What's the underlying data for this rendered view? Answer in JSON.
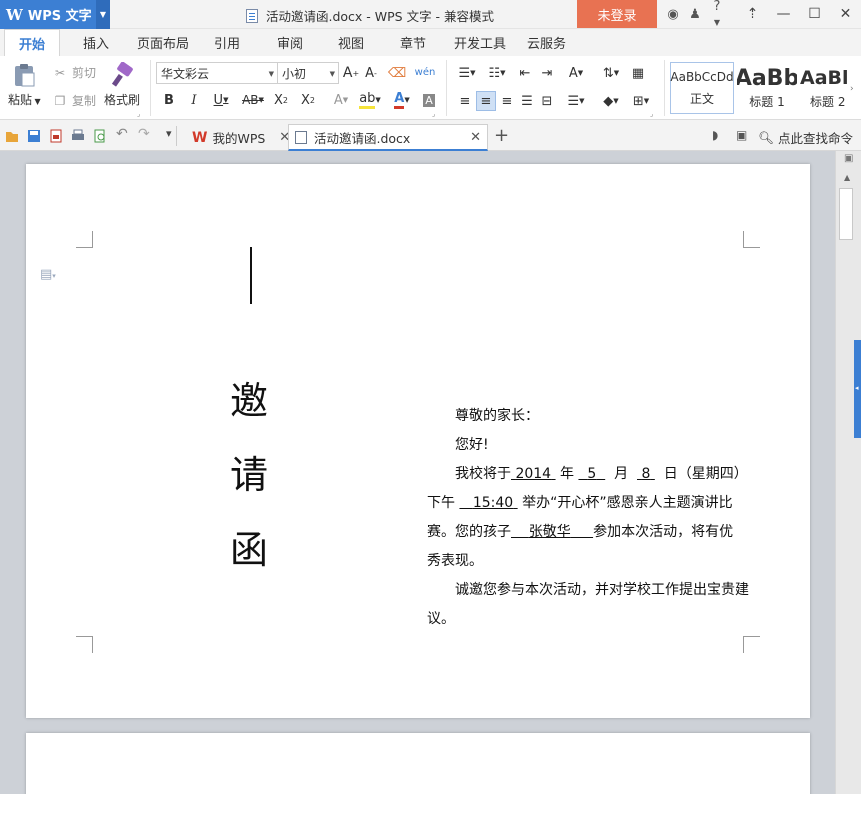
{
  "titlebar": {
    "app_name": "WPS 文字",
    "doc_title": "活动邀请函.docx - WPS 文字 - 兼容模式",
    "login_label": "未登录",
    "help_label": "?"
  },
  "ribbon_tabs": [
    "开始",
    "插入",
    "页面布局",
    "引用",
    "审阅",
    "视图",
    "章节",
    "开发工具",
    "云服务"
  ],
  "clipboard": {
    "paste": "粘贴",
    "cut": "剪切",
    "copy": "复制",
    "format_painter": "格式刷"
  },
  "font": {
    "family": "华文彩云",
    "size": "小初"
  },
  "styles": [
    {
      "preview": "AaBbCcDd",
      "name": "正文"
    },
    {
      "preview": "AaBb",
      "name": "标题 1"
    },
    {
      "preview": "AaBl",
      "name": "标题 2"
    }
  ],
  "doc_tabs": [
    {
      "label": "我的WPS"
    },
    {
      "label": "活动邀请函.docx"
    }
  ],
  "search_cmd": "点此查找命令",
  "document": {
    "title_chars": [
      "邀",
      "请",
      "函"
    ],
    "greeting": "尊敬的家长：",
    "hello": "您好!",
    "p1_a": "我校将于",
    "year": "2014",
    "p1_b": "年",
    "month": "5",
    "p1_c": "月",
    "day": "8",
    "p1_d": "日（星期四）",
    "p2_a": "下午",
    "time": "15:40",
    "p2_b": "举办“开心杯”感恩亲人主题演讲比",
    "p3_a": "赛。您的孩子",
    "child": "张敬华",
    "p3_b": "参加本次活动，将有优",
    "p4": "秀表现。",
    "p5": "诚邀您参与本次活动，并对学校工作提出宝贵建",
    "p6": "议。"
  },
  "colors": {
    "accent": "#3c7fd3",
    "login": "#e87252",
    "workspace": "#cdd1d7"
  }
}
